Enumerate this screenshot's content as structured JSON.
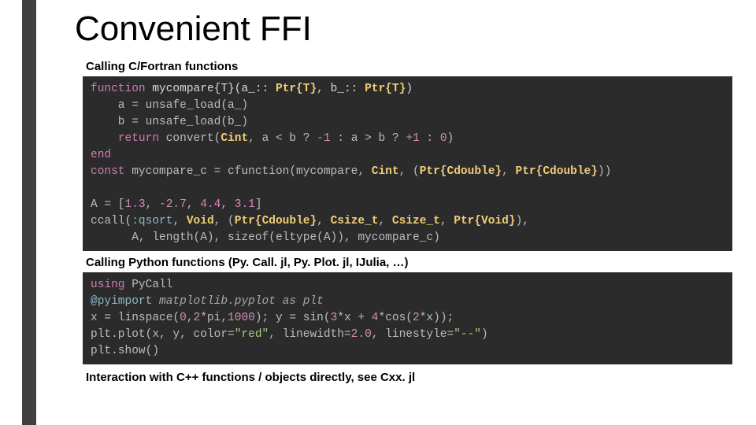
{
  "title": "Convenient FFI",
  "section1": "Calling C/Fortran functions",
  "section2": "Calling Python functions (Py. Call. jl, Py. Plot. jl, IJulia, …)",
  "section3": "Interaction with C++ functions / objects directly, see Cxx. jl",
  "code1": {
    "l1": {
      "kw": "function",
      "name": " mycompare{T}(a_:: ",
      "ty1": "Ptr{T}",
      "mid": ", b_:: ",
      "ty2": "Ptr{T}",
      "end": ")"
    },
    "l2": "    a = unsafe_load(a_)",
    "l3": "    b = unsafe_load(b_)",
    "l4": {
      "ind": "    ",
      "kw": "return",
      "txt1": " convert(",
      "ty": "Cint",
      "txt2": ", a < b ? ",
      "n1": "-1",
      "txt3": " : a > b ? ",
      "n2": "+1",
      "txt4": " : ",
      "n3": "0",
      "txt5": ")"
    },
    "l5": "end",
    "l6": {
      "kw": "const",
      "txt1": " mycompare_c = cfunction(mycompare, ",
      "ty1": "Cint",
      "txt2": ", (",
      "ty2": "Ptr{Cdouble}",
      "txt3": ", ",
      "ty3": "Ptr{Cdouble}",
      "txt4": "))"
    },
    "l7": "",
    "l8": {
      "txt1": "A = [",
      "n1": "1.3",
      "c1": ", ",
      "n2": "-2.7",
      "c2": ", ",
      "n3": "4.4",
      "c3": ", ",
      "n4": "3.1",
      "txt2": "]"
    },
    "l9": {
      "txt1": "ccall(",
      "sym": ":qsort",
      "c1": ", ",
      "ty1": "Void",
      "c2": ", (",
      "ty2": "Ptr{Cdouble}",
      "c3": ", ",
      "ty3": "Csize_t",
      "c4": ", ",
      "ty4": "Csize_t",
      "c5": ", ",
      "ty5": "Ptr{Void}",
      "txt2": "),"
    },
    "l10": "      A, length(A), sizeof(eltype(A)), mycompare_c)"
  },
  "code2": {
    "l1": {
      "kw": "using",
      "txt": " PyCall"
    },
    "l2": {
      "mac": "@pyimport",
      "txt": " matplotlib.pyplot as plt"
    },
    "l3": {
      "txt1": "x = linspace(",
      "n1": "0",
      "c1": ",",
      "n2": "2",
      "c2": "*pi,",
      "n3": "1000",
      "txt2": "); y = sin(",
      "n4": "3",
      "txt3": "*x + ",
      "n5": "4",
      "txt4": "*cos(",
      "n6": "2",
      "txt5": "*x));"
    },
    "l4": {
      "txt1": "plt.plot(x, y, color=",
      "s1": "\"red\"",
      "txt2": ", linewidth=",
      "n1": "2.0",
      "txt3": ", linestyle=",
      "s2": "\"--\"",
      "txt4": ")"
    },
    "l5": "plt.show()"
  }
}
